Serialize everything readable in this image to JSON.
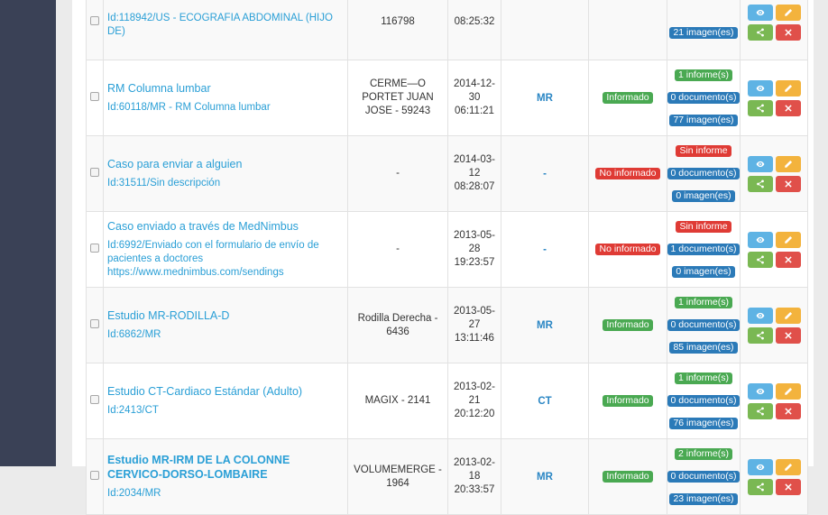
{
  "rows": [
    {
      "title": "",
      "desc": "Id:118942/US - ECOGRAFIA ABDOMINAL (HIJO DE)",
      "source": "116798",
      "date": [
        "",
        "",
        "08:25:32"
      ],
      "modality": "",
      "status": "",
      "counts": [
        "",
        "",
        "21 imagen(es)"
      ]
    },
    {
      "title": "RM Columna lumbar",
      "desc": "Id:60118/MR - RM Columna lumbar",
      "source": "CERME—O PORTET JUAN JOSE - 59243",
      "date": [
        "2014-12-",
        "30",
        "06:11:21"
      ],
      "modality": "MR",
      "status": "Informado",
      "counts": [
        "1 informe(s)",
        "0 documento(s)",
        "77 imagen(es)"
      ]
    },
    {
      "title": "Caso para enviar a alguien",
      "desc": "Id:31511/Sin descripción",
      "source": "-",
      "date": [
        "2014-03-",
        "12",
        "08:28:07"
      ],
      "modality": "-",
      "status": "No informado",
      "counts": [
        "Sin informe",
        "0 documento(s)",
        "0 imagen(es)"
      ]
    },
    {
      "title": "Caso enviado a través de MedNimbus",
      "desc": "Id:6992/Enviado con el formulario de envío de pacientes a doctores https://www.mednimbus.com/sendings",
      "source": "-",
      "date": [
        "2013-05-",
        "28",
        "19:23:57"
      ],
      "modality": "-",
      "status": "No informado",
      "counts": [
        "Sin informe",
        "1 documento(s)",
        "0 imagen(es)"
      ]
    },
    {
      "title": "Estudio MR-RODILLA-D",
      "desc": "Id:6862/MR",
      "source": "Rodilla Derecha - 6436",
      "date": [
        "2013-05-",
        "27",
        "13:11:46"
      ],
      "modality": "MR",
      "status": "Informado",
      "counts": [
        "1 informe(s)",
        "0 documento(s)",
        "85 imagen(es)"
      ]
    },
    {
      "title": "Estudio CT-Cardiaco Estándar (Adulto)",
      "desc": "Id:2413/CT",
      "source": "MAGIX - 2141",
      "date": [
        "2013-02-",
        "21",
        "20:12:20"
      ],
      "modality": "CT",
      "status": "Informado",
      "counts": [
        "1 informe(s)",
        "0 documento(s)",
        "76 imagen(es)"
      ]
    },
    {
      "title": "Estudio MR-IRM DE LA COLONNE CERVICO-DORSO-LOMBAIRE",
      "desc": "Id:2034/MR",
      "source": "VOLUMEMERGE - 1964",
      "date": [
        "2013-02-",
        "18",
        "20:33:57"
      ],
      "modality": "MR",
      "status": "Informado",
      "counts": [
        "2 informe(s)",
        "0 documento(s)",
        "23 imagen(es)"
      ]
    }
  ],
  "colors": {
    "sidebar": "#3a4156",
    "link": "#2a9fd6",
    "green": "#4aa952",
    "red": "#df3b35",
    "blue": "#2b7ab8",
    "btn_view": "#5eb3e4",
    "btn_edit": "#f3b33d",
    "btn_share": "#7ab853",
    "btn_del": "#e0504a"
  },
  "icons": {
    "view": "eye-icon",
    "edit": "pencil-icon",
    "share": "share-icon",
    "delete": "close-icon"
  }
}
